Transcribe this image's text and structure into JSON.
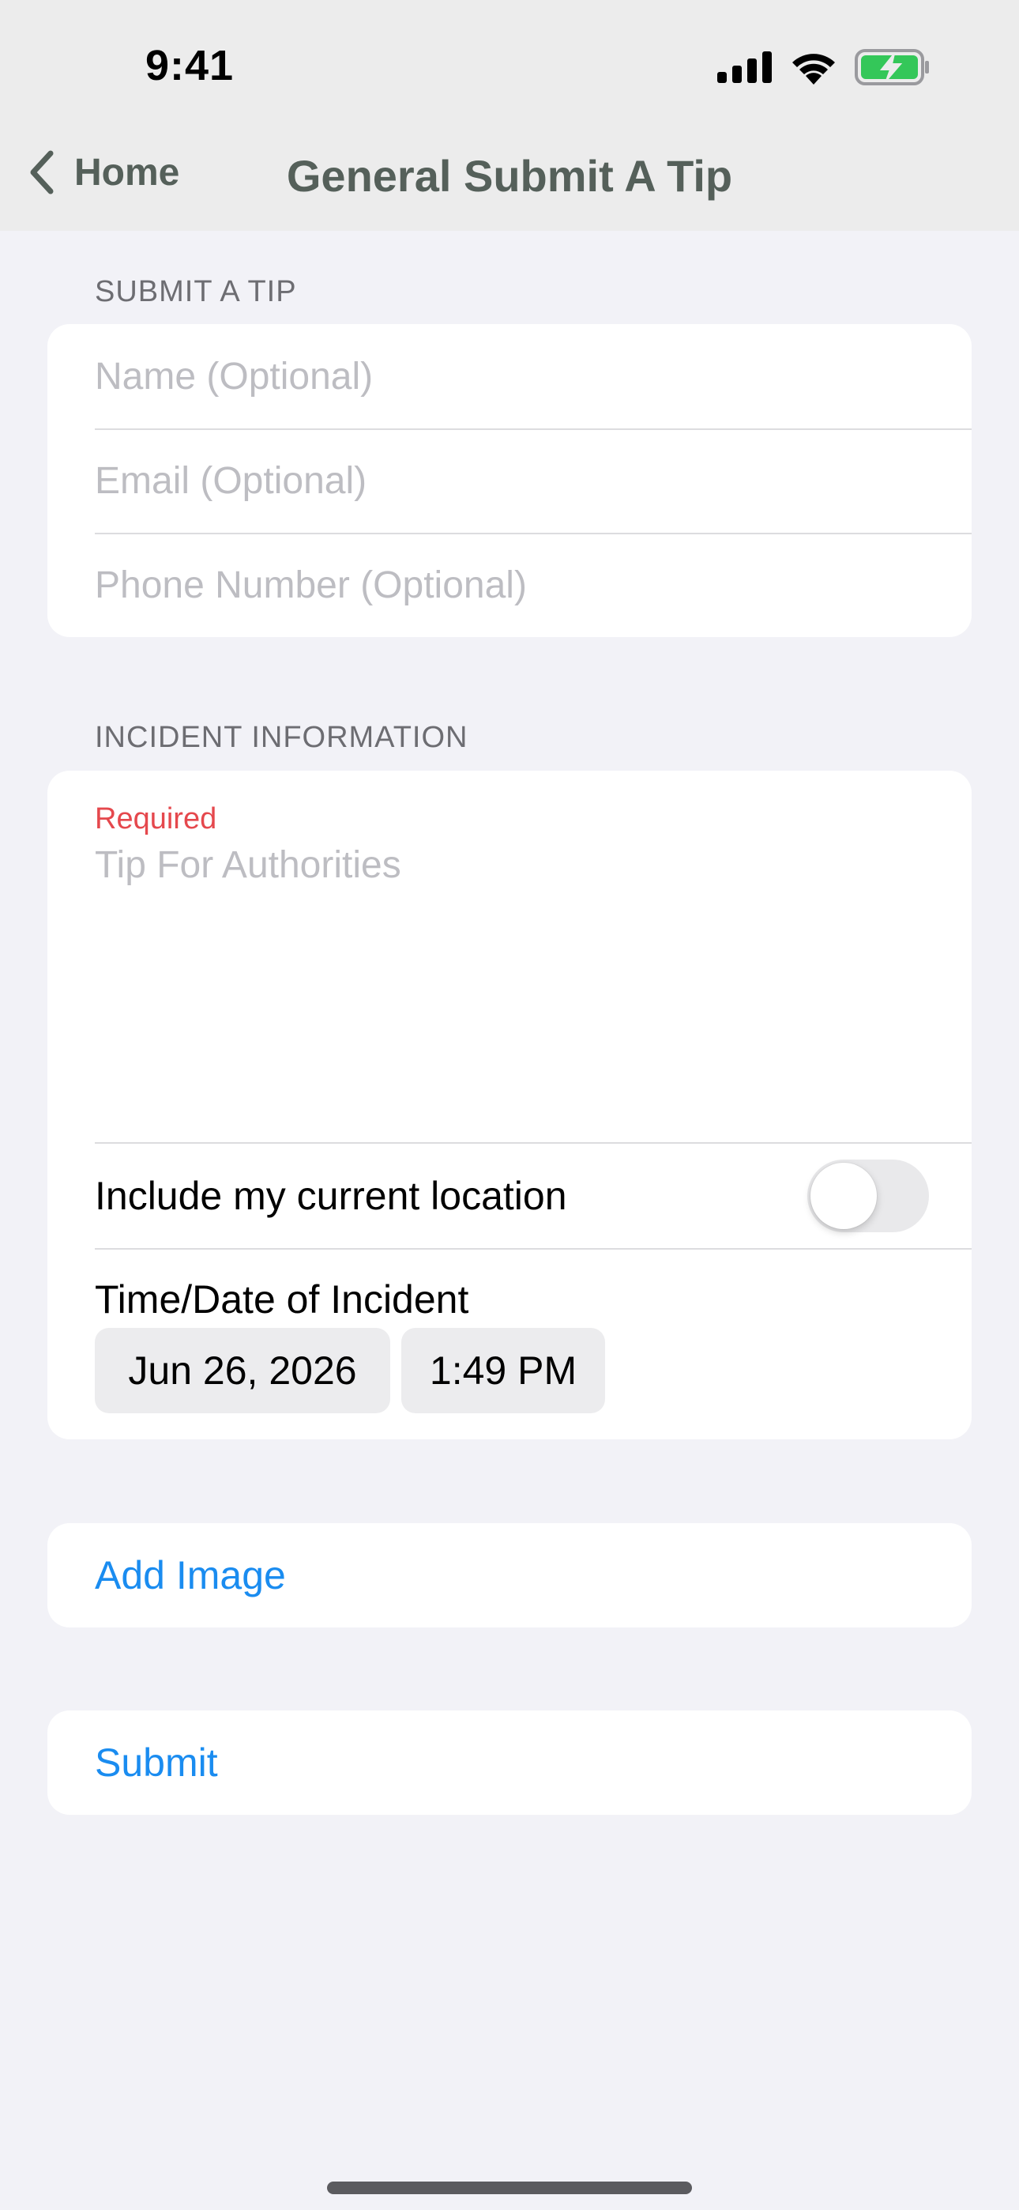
{
  "status_bar": {
    "time": "9:41",
    "icons": [
      "cellular-signal-icon",
      "wifi-icon",
      "battery-charging-icon"
    ],
    "battery_color": "#34c759"
  },
  "nav": {
    "back_label": "Home",
    "title": "General Submit A Tip"
  },
  "submit_section": {
    "header": "SUBMIT A TIP",
    "fields": {
      "name_placeholder": "Name (Optional)",
      "email_placeholder": "Email (Optional)",
      "phone_placeholder": "Phone Number (Optional)"
    }
  },
  "incident_section": {
    "header": "INCIDENT INFORMATION",
    "required_label": "Required",
    "tip_placeholder": "Tip For Authorities",
    "location_label": "Include my current location",
    "location_enabled": false,
    "datetime_label": "Time/Date of Incident",
    "date_value": "Jun 26, 2026",
    "time_value": "1:49 PM"
  },
  "actions": {
    "add_image": "Add Image",
    "submit": "Submit"
  },
  "colors": {
    "accent": "#1a8cf0",
    "required": "#e5484d",
    "background": "#f2f2f7"
  }
}
